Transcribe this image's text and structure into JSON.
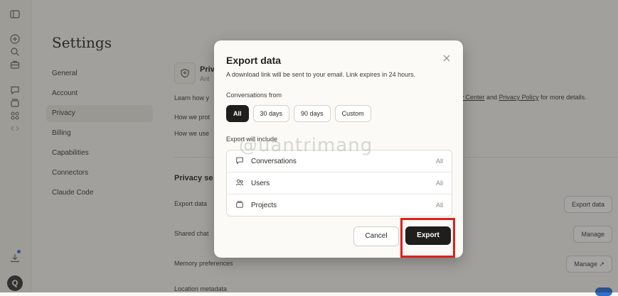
{
  "sidebar": {
    "icons": [
      "sidebar-toggle-icon",
      "new-chat-icon",
      "search-icon",
      "briefcase-icon",
      "chat-icon",
      "projects-icon",
      "artifacts-icon",
      "code-icon",
      "download-icon"
    ],
    "avatar_initial": "Q"
  },
  "settings": {
    "title": "Settings",
    "nav": [
      {
        "label": "General"
      },
      {
        "label": "Account"
      },
      {
        "label": "Privacy"
      },
      {
        "label": "Billing"
      },
      {
        "label": "Capabilities"
      },
      {
        "label": "Connectors"
      },
      {
        "label": "Claude Code"
      }
    ],
    "privacy_header_title": "Priv",
    "privacy_header_sub": "Ant",
    "learn_prefix": "Learn how y",
    "right_text_tail": "acy Center",
    "right_and": " and ",
    "right_link2": "Privacy Policy",
    "right_suffix": " for more details.",
    "how_protect": "How we prot",
    "how_use": "How we use",
    "privacy_settings_title": "Privacy se",
    "rows": {
      "export_data_label": "Export data",
      "shared_chat_label": "Shared chat",
      "memory_label": "Memory preferences",
      "location_label": "Location metadata"
    },
    "buttons": {
      "export_data": "Export data",
      "manage": "Manage",
      "manage_ext": "Manage ↗"
    }
  },
  "modal": {
    "title": "Export data",
    "description": "A download link will be sent to your email. Link expires in 24 hours.",
    "conversations_from_label": "Conversations from",
    "range_options": [
      "All",
      "30 days",
      "90 days",
      "Custom"
    ],
    "selected_range": "All",
    "export_include_label": "Export will include",
    "include_items": [
      {
        "label": "Conversations",
        "value": "All",
        "icon": "chat-icon"
      },
      {
        "label": "Users",
        "value": "All",
        "icon": "users-icon"
      },
      {
        "label": "Projects",
        "value": "All",
        "icon": "projects-icon"
      }
    ],
    "cancel_label": "Cancel",
    "export_label": "Export"
  },
  "watermark": "@uantrimang",
  "colors": {
    "highlight": "#e0201b",
    "primary_button": "#1f1e1c",
    "toggle_on": "#2f6fd3"
  }
}
